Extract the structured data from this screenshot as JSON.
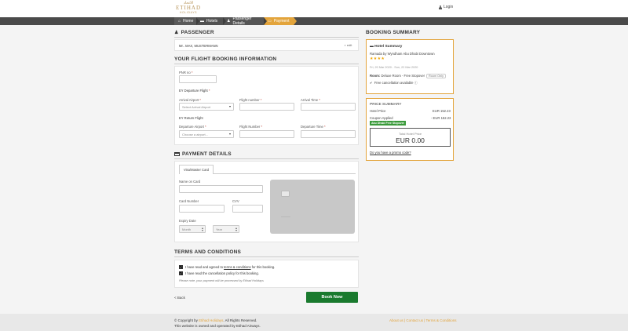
{
  "header": {
    "logo_arabic": "الاتحاد",
    "logo_brand": "ETIHAD",
    "logo_sub": "HOLIDAYS",
    "login_label": "Login"
  },
  "nav": {
    "items": [
      {
        "label": "Home",
        "icon": "home-icon"
      },
      {
        "label": "Hotels",
        "icon": "bed-icon"
      },
      {
        "label": "Passenger Details",
        "icon": "person-icon"
      },
      {
        "label": "Payment",
        "icon": "credit-card-icon"
      }
    ],
    "active_color": "#e3a43b"
  },
  "passenger": {
    "title": "PASSENGER",
    "name": "Mr.. MAX, MUSTERMANN",
    "edit_label": "edit"
  },
  "flight": {
    "title": "YOUR FLIGHT BOOKING INFORMATION",
    "pnr_label": "PNR no",
    "departure_title": "EY Departure Flight",
    "arrival_airport_label": "Arrival Airport",
    "arrival_airport_placeholder": "Select Arrival Airport",
    "flight_number_label": "Flight number",
    "arrival_time_label": "Arrival Time",
    "return_title": "EY Return Flight",
    "departure_airport_label": "Departure Airport",
    "departure_airport_placeholder": "Choose a airport...",
    "return_flight_number_label": "Flight Number",
    "departure_time_label": "Departure Time"
  },
  "payment": {
    "title": "PAYMENT DETAILS",
    "tab_label": "Visa/Master Card",
    "name_label": "Name on Card",
    "card_number_label": "Card Number",
    "cvv_label": "CVV",
    "expiry_label": "Expiry Date",
    "month_placeholder": "Month",
    "year_placeholder": "Year"
  },
  "terms": {
    "title": "TERMS AND CONDITIONS",
    "line1_pre": "I have read and agreed to ",
    "line1_link": "terms & conditions",
    "line1_post": " for this booking.",
    "line2": "I have read the cancellation policy for this booking.",
    "note": "Please note, your payment will be processed by Etihad Holidays"
  },
  "actions": {
    "back_label": "< Back",
    "book_label": "Book Now"
  },
  "summary": {
    "title": "BOOKING SUMMARY",
    "hotel_heading": "Hotel Summary",
    "hotel_name": "Ramada by Wyndham Abu Dhabi Downtown",
    "rating": 4,
    "stars": "★★★★",
    "dates": "Fri, 20 Mar 2020 - Sun, 22 Mar 2020",
    "room_label": "Room:",
    "room_value": "Deluxe Room - Free Stopover",
    "board_badge": "Room Only",
    "cancellation": "Free cancellation available",
    "price_title": "PRICE SUMMARY",
    "hotel_price_label": "Hotel Price",
    "hotel_price_value": "EUR 152.23",
    "coupon_label": "Coupon Applied",
    "coupon_value": "- EUR 152.23",
    "coupon_tag": "Abu Dhabi Free Stopover",
    "total_label": "Total Hotel Price",
    "total_value": "EUR 0.00",
    "promo_link": "Do you have a promo code?"
  },
  "footer": {
    "copyright_pre": "© Copyright by ",
    "copyright_link": "Etihad Holidays",
    "copyright_post": ". All Rights Reserved.",
    "operated": "This website is owned and operated by Etihad Airways.",
    "links": "About us | Contact us | Terms & Conditions"
  }
}
